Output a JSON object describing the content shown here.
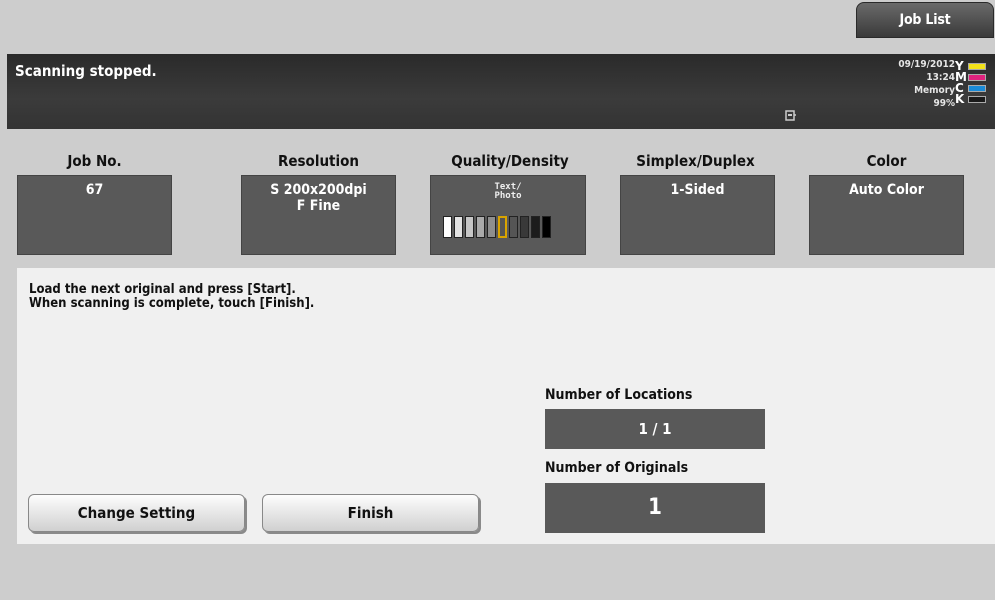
{
  "header": {
    "job_list_label": "Job List"
  },
  "status": {
    "message": "Scanning stopped.",
    "date": "09/19/2012",
    "time": "13:24",
    "memory_label": "Memory",
    "memory_value": "99%",
    "toner": [
      {
        "letter": "Y",
        "color": "#f2e21a"
      },
      {
        "letter": "M",
        "color": "#e0237e"
      },
      {
        "letter": "C",
        "color": "#1a8ad6"
      },
      {
        "letter": "K",
        "color": "#1a1a1a"
      }
    ]
  },
  "settings": {
    "job_no": {
      "label": "Job No.",
      "value": "67"
    },
    "resolution": {
      "label": "Resolution",
      "line1": "S 200x200dpi",
      "line2": "F Fine"
    },
    "quality": {
      "label": "Quality/Density",
      "mode_line1": "Text/",
      "mode_line2": "Photo",
      "density_level": 6,
      "density_steps": 10
    },
    "duplex": {
      "label": "Simplex/Duplex",
      "value": "1-Sided"
    },
    "color": {
      "label": "Color",
      "value": "Auto Color"
    }
  },
  "instructions": {
    "line1": "Load the next original and press [Start].",
    "line2": "When scanning is complete, touch [Finish]."
  },
  "locations": {
    "label": "Number of Locations",
    "value": "1 / 1"
  },
  "originals": {
    "label": "Number of Originals",
    "value": "1"
  },
  "buttons": {
    "change_setting": "Change Setting",
    "finish": "Finish"
  }
}
